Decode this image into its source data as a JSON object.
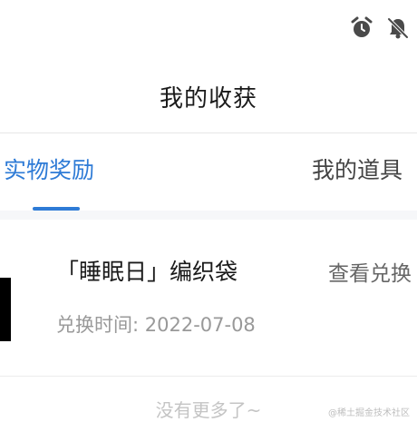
{
  "status_bar": {
    "icons": [
      "alarm-clock-icon",
      "notifications-off-icon"
    ]
  },
  "header": {
    "title": "我的收获"
  },
  "tabs": [
    {
      "label": "实物奖励",
      "active": true
    },
    {
      "label": "我的道具",
      "active": false
    }
  ],
  "prizes": [
    {
      "name": "「睡眠日」编织袋",
      "action_label": "查看兑换",
      "redeem_time": "兑换时间: 2022-07-08"
    }
  ],
  "empty_message": "没有更多了~",
  "watermark": "@稀土掘金技术社区",
  "colors": {
    "accent": "#2e7bd6",
    "muted_text": "#999999"
  }
}
